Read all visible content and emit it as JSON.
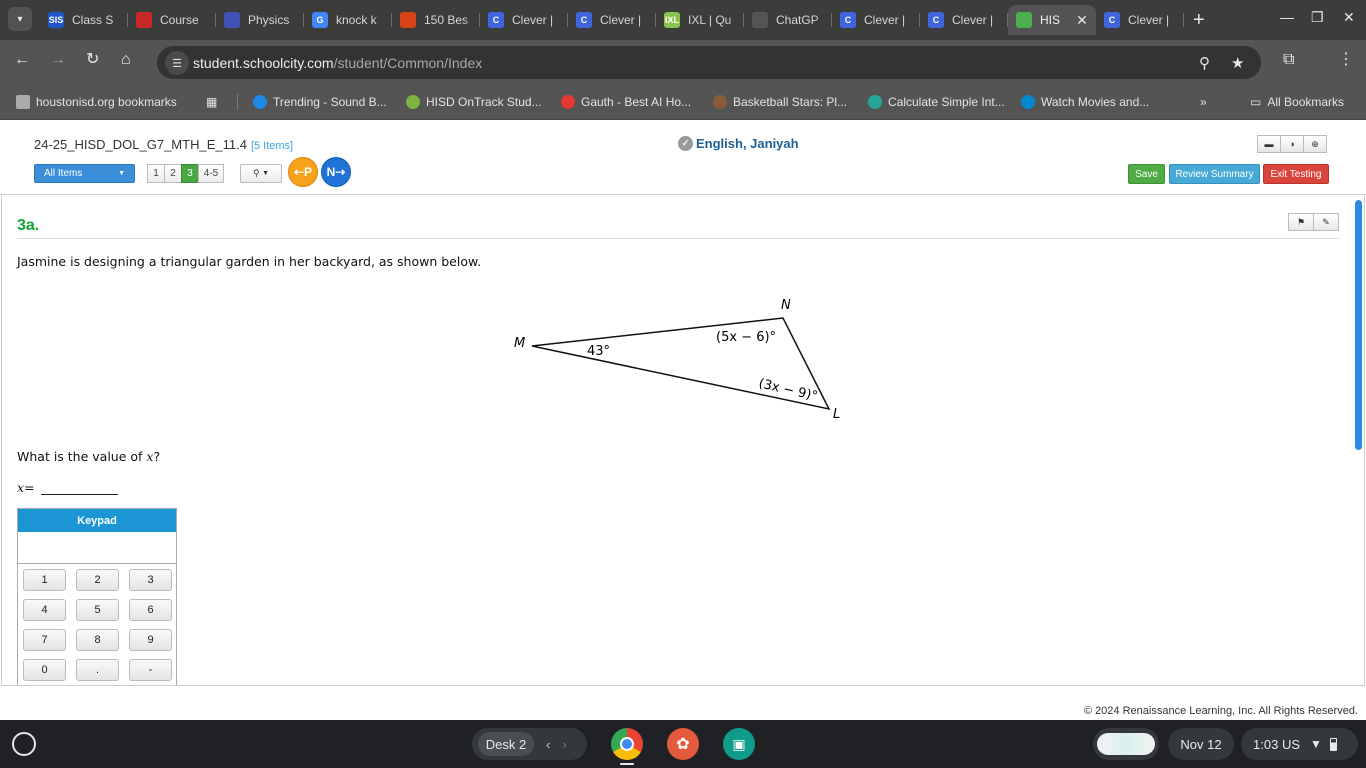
{
  "browser": {
    "tabs": [
      {
        "title": "Class S",
        "fav": "SIS",
        "color": "#1e55c8"
      },
      {
        "title": "Course",
        "fav": "",
        "color": "#c62828"
      },
      {
        "title": "Physics",
        "fav": "",
        "color": "#3f51b5"
      },
      {
        "title": "knock k",
        "fav": "G",
        "color": "#4285f4"
      },
      {
        "title": "150 Bes",
        "fav": "",
        "color": "#d84315"
      },
      {
        "title": "Clever |",
        "fav": "C",
        "color": "#3e63dd"
      },
      {
        "title": "Clever |",
        "fav": "C",
        "color": "#3e63dd"
      },
      {
        "title": "IXL | Qu",
        "fav": "IXL",
        "color": "#8bc34a"
      },
      {
        "title": "ChatGP",
        "fav": "",
        "color": "#555555"
      },
      {
        "title": "Clever |",
        "fav": "C",
        "color": "#3e63dd"
      },
      {
        "title": "Clever |",
        "fav": "C",
        "color": "#3e63dd"
      },
      {
        "title": "HIS",
        "fav": "",
        "color": "#4caf50",
        "active": true
      },
      {
        "title": "Clever |",
        "fav": "C",
        "color": "#3e63dd"
      }
    ],
    "url_domain": "student.schoolcity.com",
    "url_path": "/student/Common/Index",
    "bookmarks": [
      {
        "label": "houstonisd.org bookmarks",
        "color": "#aaaaaa"
      },
      {
        "label": "Trending - Sound B...",
        "color": "#1e88e5"
      },
      {
        "label": "HISD OnTrack Stud...",
        "color": "#7cb342"
      },
      {
        "label": "Gauth - Best AI Ho...",
        "color": "#e53935"
      },
      {
        "label": "Basketball Stars: Pl...",
        "color": "#8e5b3a"
      },
      {
        "label": "Calculate Simple Int...",
        "color": "#26a69a"
      },
      {
        "label": "Watch Movies and...",
        "color": "#0288d1"
      }
    ],
    "all_bookmarks": "All Bookmarks"
  },
  "test": {
    "title": "24-25_HISD_DOL_G7_MTH_E_11.4",
    "count": "[5 Items]",
    "student": "English, Janiyah",
    "all_items": "All Items",
    "pages": [
      "1",
      "2",
      "3",
      "4-5"
    ],
    "current_page": "3",
    "prev_label": "P",
    "next_label": "N",
    "save": "Save",
    "review": "Review Summary",
    "exit": "Exit Testing"
  },
  "question": {
    "number": "3a.",
    "stem": "Jasmine is designing a triangular garden in her backyard, as shown below.",
    "figure": {
      "vertex_m": "M",
      "vertex_n": "N",
      "vertex_l": "L",
      "angle_m": "43°",
      "angle_n": "(5x − 6)°",
      "angle_l": "(3x − 9)°"
    },
    "ask_prefix": "What is the value of ",
    "ask_var": "x",
    "ask_suffix": "?",
    "answer_var": "x",
    "answer_eq": " ="
  },
  "keypad": {
    "title": "Keypad",
    "keys": [
      "1",
      "2",
      "3",
      "4",
      "5",
      "6",
      "7",
      "8",
      "9",
      "0",
      ".",
      "-"
    ]
  },
  "footer": {
    "copyright": "© 2024 Renaissance Learning, Inc. All Rights Reserved."
  },
  "shelf": {
    "desk": "Desk 2",
    "date": "Nov 12",
    "time": "1:03",
    "locale": "US"
  }
}
